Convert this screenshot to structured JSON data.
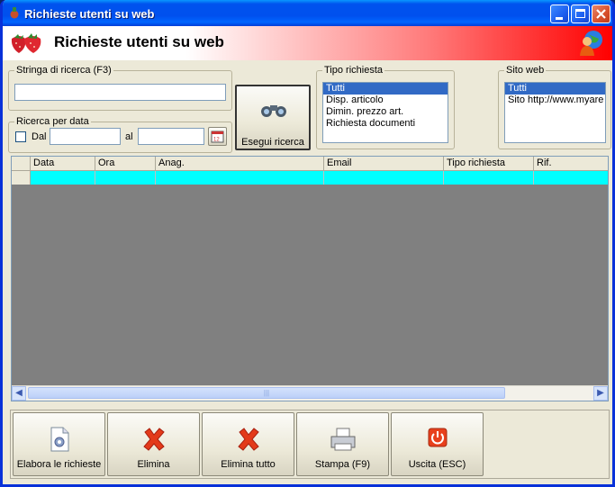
{
  "window": {
    "title": "Richieste utenti su web"
  },
  "header": {
    "title": "Richieste utenti su web"
  },
  "search": {
    "group_label": "Stringa di ricerca (F3)",
    "value": ""
  },
  "date_search": {
    "group_label": "Ricerca per data",
    "from_label": "Dal",
    "from_value": "",
    "to_label": "al",
    "to_value": ""
  },
  "search_button": {
    "label": "Esegui ricerca"
  },
  "tipo_richiesta": {
    "group_label": "Tipo richiesta",
    "items": [
      "Tutti",
      "Disp. articolo",
      "Dimin. prezzo art.",
      "Richiesta documenti"
    ],
    "selected": "Tutti"
  },
  "sito_web": {
    "group_label": "Sito web",
    "items": [
      "Tutti",
      "Sito http://www.myare"
    ],
    "selected": "Tutti"
  },
  "grid": {
    "columns": [
      "Data",
      "Ora",
      "Anag.",
      "Email",
      "Tipo richiesta",
      "Rif."
    ],
    "row_color": "#00ffff"
  },
  "actions": [
    {
      "label": "Elabora le richieste",
      "icon": "document-gear-icon"
    },
    {
      "label": "Elimina",
      "icon": "red-x-icon"
    },
    {
      "label": "Elimina tutto",
      "icon": "red-x-icon"
    },
    {
      "label": "Stampa (F9)",
      "icon": "printer-icon"
    },
    {
      "label": "Uscita (ESC)",
      "icon": "power-icon"
    }
  ],
  "colors": {
    "titlebar": "#0053ee",
    "header_accent": "#ff0000",
    "selection": "#316ac5"
  }
}
